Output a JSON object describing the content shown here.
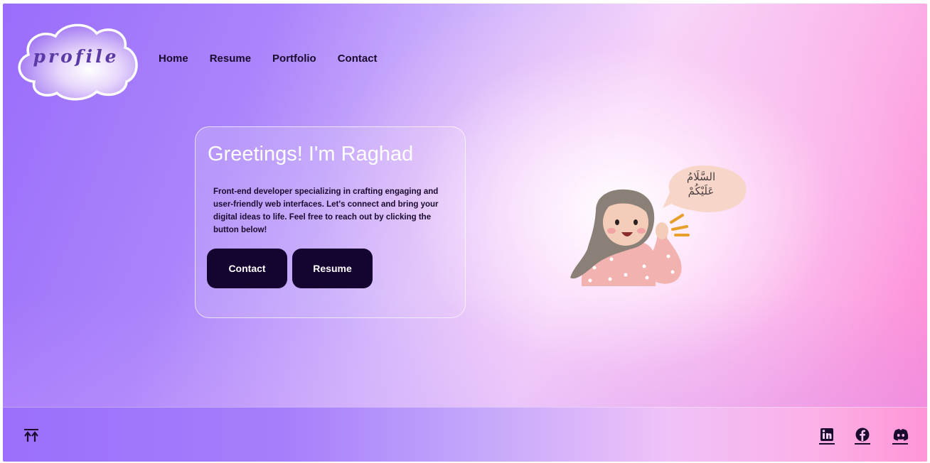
{
  "brand": {
    "logo_text": "profile"
  },
  "nav": {
    "items": [
      "Home",
      "Resume",
      "Portfolio",
      "Contact"
    ]
  },
  "hero": {
    "title": "Greetings! I'm Raghad",
    "description": "Front-end developer specializing in crafting engaging and user-friendly web interfaces. Let's connect and bring your digital ideas to life. Feel free to reach out by clicking the button below!",
    "buttons": {
      "contact": "Contact",
      "resume": "Resume"
    },
    "illustration": {
      "speech_line1": "السَّلَامُ",
      "speech_line2": "عَلَيْكُمْ"
    }
  },
  "footer": {
    "back_to_top_icon": "arrow-up-double-icon",
    "social": [
      "linkedin-icon",
      "facebook-icon",
      "discord-icon"
    ]
  },
  "colors": {
    "text_dark": "#1a0b2e",
    "button_bg": "#140430",
    "logo_text": "#5b3aa6",
    "gradient_purple": "#9a6dfb",
    "gradient_pink": "#ff8ad4"
  }
}
